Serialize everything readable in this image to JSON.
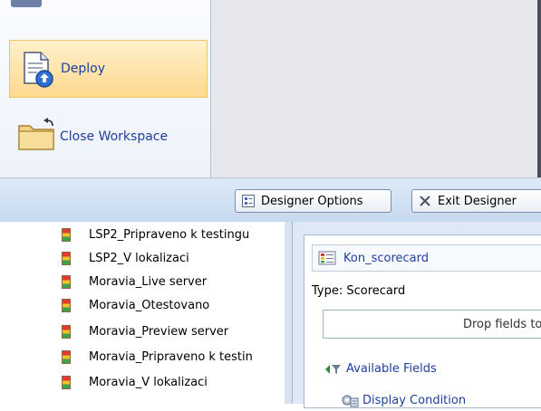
{
  "menu": {
    "deploy_label": "Deploy",
    "close_workspace_label": "Close Workspace"
  },
  "toolbar": {
    "designer_options_label": "Designer Options",
    "exit_designer_label": "Exit Designer"
  },
  "list": {
    "items": [
      "LSP2_Pripraveno k testingu",
      "LSP2_V lokalizaci",
      "Moravia_Live server",
      "Moravia_Otestovano",
      "Moravia_Preview server",
      "Moravia_Pripraveno k testin",
      "Moravia_V lokalizaci"
    ]
  },
  "designer": {
    "scorecard_name": "Kon_scorecard",
    "type_line": "Type:  Scorecard",
    "drop_zone_text": "Drop fields to cr",
    "available_fields_label": "Available Fields",
    "display_condition_label": "Display Condition"
  },
  "colors": {
    "link": "#1f3ea0",
    "highlight": "#ffd98e",
    "toolbar": "#c7d9ef"
  }
}
